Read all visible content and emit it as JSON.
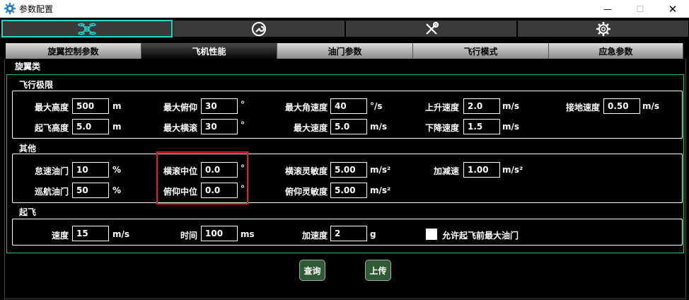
{
  "window": {
    "title": "参数配置",
    "app_icon": "gear-icon",
    "min_glyph": "—",
    "max_glyph": "☐",
    "close_glyph": "✕"
  },
  "top_tabs": [
    {
      "icon": "drone-icon"
    },
    {
      "icon": "wrench-circle-icon"
    },
    {
      "icon": "tools-icon"
    },
    {
      "icon": "gear-icon"
    }
  ],
  "sub_tabs": [
    "旋翼控制参数",
    "飞机性能",
    "油门参数",
    "飞行模式",
    "应急参数"
  ],
  "active_sub_tab": "飞机性能",
  "category_label": "旋翼类",
  "flight_limits": {
    "title": "飞行极限",
    "max_altitude": {
      "label": "最大高度",
      "value": "500",
      "unit": "m"
    },
    "max_pitch": {
      "label": "最大俯仰",
      "value": "30",
      "unit": "°"
    },
    "max_angular_speed": {
      "label": "最大角速度",
      "value": "40",
      "unit": "°/s"
    },
    "climb_speed": {
      "label": "上升速度",
      "value": "2.0",
      "unit": "m/s"
    },
    "touchdown_speed": {
      "label": "接地速度",
      "value": "0.50",
      "unit": "m/s"
    },
    "takeoff_altitude": {
      "label": "起飞高度",
      "value": "5.0",
      "unit": "m"
    },
    "max_roll": {
      "label": "最大横滚",
      "value": "30",
      "unit": "°"
    },
    "max_speed": {
      "label": "最大速度",
      "value": "5.0",
      "unit": "m/s"
    },
    "descent_speed": {
      "label": "下降速度",
      "value": "1.5",
      "unit": "m/s"
    }
  },
  "other": {
    "title": "其他",
    "idle_throttle": {
      "label": "怠速油门",
      "value": "10",
      "unit": "%"
    },
    "roll_neutral": {
      "label": "横滚中位",
      "value": "0.0",
      "unit": "°"
    },
    "roll_sensitivity": {
      "label": "横滚灵敏度",
      "value": "5.00",
      "unit": "m/s²"
    },
    "acceleration": {
      "label": "加减速",
      "value": "1.00",
      "unit": "m/s²"
    },
    "cruise_throttle": {
      "label": "巡航油门",
      "value": "50",
      "unit": "%"
    },
    "pitch_neutral": {
      "label": "俯仰中位",
      "value": "0.0",
      "unit": "°"
    },
    "pitch_sensitivity": {
      "label": "俯仰灵敏度",
      "value": "5.00",
      "unit": "m/s²"
    }
  },
  "takeoff": {
    "title": "起飞",
    "speed": {
      "label": "速度",
      "value": "15",
      "unit": "m/s"
    },
    "time": {
      "label": "时间",
      "value": "100",
      "unit": "ms"
    },
    "accel": {
      "label": "加速度",
      "value": "2",
      "unit": "g"
    },
    "allow_max_throttle": {
      "label": "允许起飞前最大油门",
      "checked": false
    }
  },
  "buttons": {
    "query": "查询",
    "upload": "上传"
  },
  "colors": {
    "accent_cyan": "#21d4d0",
    "group_green": "#21c34e",
    "highlight_red": "#e02020",
    "button_green": "#2e5a36"
  }
}
